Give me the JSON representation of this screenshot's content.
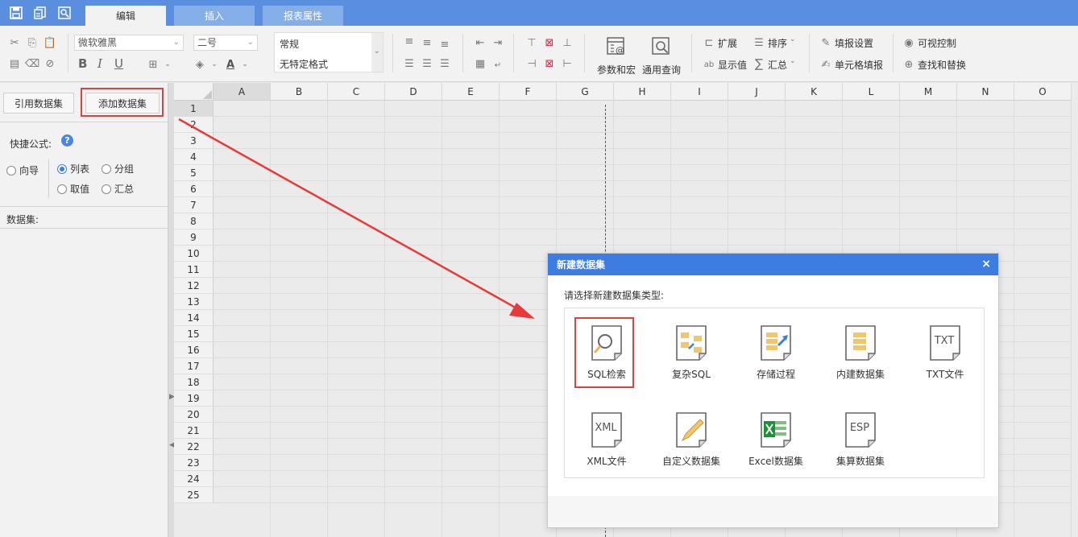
{
  "quick_toolbar": {
    "save_icon": "save-icon",
    "copy_icon": "copy-doc-icon",
    "preview_icon": "preview-icon"
  },
  "tabs": [
    {
      "label": "编辑",
      "active": true
    },
    {
      "label": "插入",
      "active": false
    },
    {
      "label": "报表属性",
      "active": false
    }
  ],
  "ribbon": {
    "font_family": "微软雅黑",
    "font_size": "二号",
    "format_normal": "常规",
    "format_none": "无特定格式",
    "bold": "B",
    "italic": "I",
    "underline": "U",
    "params_macro": "参数和宏",
    "general_query": "通用查询",
    "expand": "扩展",
    "sort": "排序",
    "show_value": "显示值",
    "summary": "汇总",
    "fill_settings": "填报设置",
    "cell_fill": "单元格填报",
    "visibility": "可视控制",
    "find_replace": "查找和替换"
  },
  "left_panel": {
    "ref_dataset": "引用数据集",
    "add_dataset": "添加数据集",
    "quick_formula": "快捷公式:",
    "help_mark": "?",
    "radios": [
      {
        "label": "向导",
        "checked": false
      },
      {
        "label": "列表",
        "checked": true
      },
      {
        "label": "分组",
        "checked": false
      },
      {
        "label": "取值",
        "checked": false
      },
      {
        "label": "汇总",
        "checked": false
      }
    ],
    "dataset_label": "数据集:"
  },
  "grid": {
    "columns": [
      "A",
      "B",
      "C",
      "D",
      "E",
      "F",
      "G",
      "H",
      "I",
      "J",
      "K",
      "L",
      "M",
      "N",
      "O"
    ],
    "rows": [
      "1",
      "2",
      "3",
      "4",
      "5",
      "6",
      "7",
      "8",
      "9",
      "10",
      "11",
      "12",
      "13",
      "14",
      "15",
      "16",
      "17",
      "18",
      "19",
      "20",
      "21",
      "22",
      "23",
      "24",
      "25"
    ],
    "selected_cell": "A1"
  },
  "dialog": {
    "title": "新建数据集",
    "close": "×",
    "prompt": "请选择新建数据集类型:",
    "items": [
      {
        "label": "SQL检索",
        "icon": "sql-search-icon",
        "glyph": ""
      },
      {
        "label": "复杂SQL",
        "icon": "complex-sql-icon",
        "glyph": ""
      },
      {
        "label": "存储过程",
        "icon": "stored-procedure-icon",
        "glyph": ""
      },
      {
        "label": "内建数据集",
        "icon": "builtin-dataset-icon",
        "glyph": ""
      },
      {
        "label": "TXT文件",
        "icon": "txt-file-icon",
        "glyph": "TXT"
      },
      {
        "label": "XML文件",
        "icon": "xml-file-icon",
        "glyph": "XML"
      },
      {
        "label": "自定义数据集",
        "icon": "custom-dataset-icon",
        "glyph": ""
      },
      {
        "label": "Excel数据集",
        "icon": "excel-dataset-icon",
        "glyph": ""
      },
      {
        "label": "集算数据集",
        "icon": "esproc-dataset-icon",
        "glyph": "ESP"
      }
    ]
  },
  "colors": {
    "titlebar": "#5a8fdf",
    "dialog_header": "#3d7ce0",
    "highlight": "#e04040",
    "accent": "#3d7ce0"
  }
}
